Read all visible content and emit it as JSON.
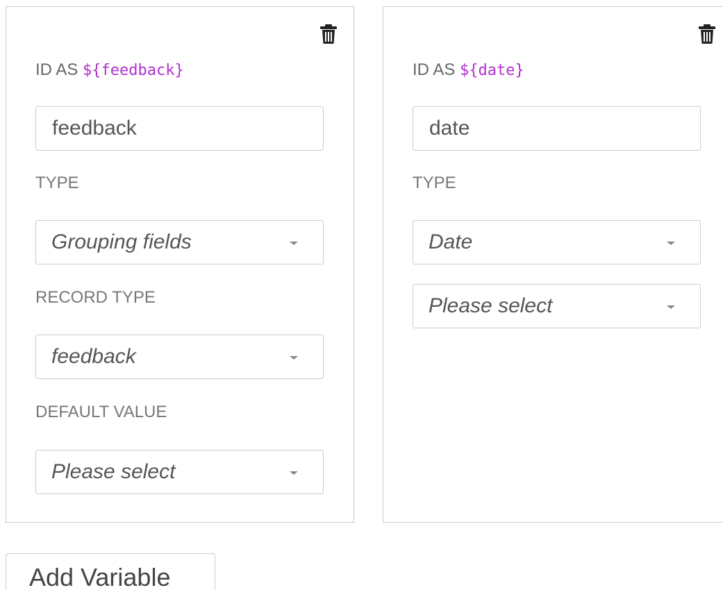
{
  "variables": [
    {
      "id_prefix": "ID AS ",
      "id_var": "${feedback}",
      "id_value": "feedback",
      "type_label": "TYPE",
      "type_value": "Grouping fields",
      "record_type_label": "RECORD TYPE",
      "record_type_value": "feedback",
      "default_value_label": "DEFAULT VALUE",
      "default_value_value": "Please select",
      "delete_icon": "trash-icon"
    },
    {
      "id_prefix": "ID AS ",
      "id_var": "${date}",
      "id_value": "date",
      "type_label": "TYPE",
      "type_value": "Date",
      "extra_select_value": "Please select",
      "delete_icon": "trash-icon"
    }
  ],
  "add_button_label": "Add Variable",
  "colors": {
    "variable_token": "#b12fd0",
    "border": "#cccccc",
    "label": "#777777"
  }
}
